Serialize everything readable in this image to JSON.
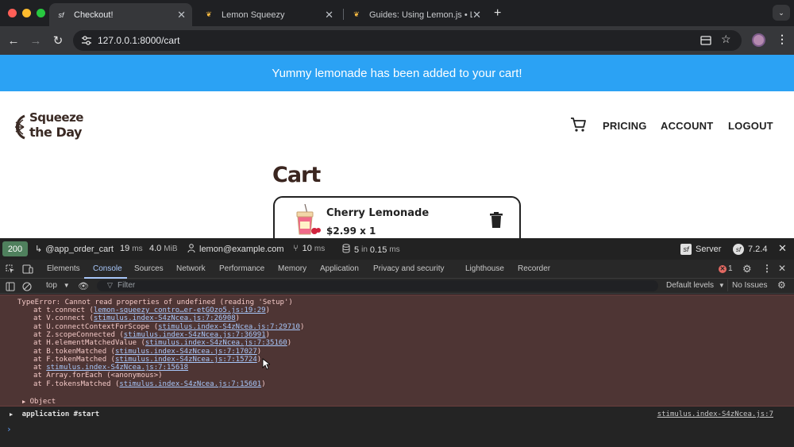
{
  "browser": {
    "tabs": [
      {
        "title": "Checkout!",
        "active": true,
        "favicon": "sf"
      },
      {
        "title": "Lemon Squeezy",
        "active": false,
        "favicon": "lemon-icon"
      },
      {
        "title": "Guides: Using Lemon.js • Lem",
        "active": false,
        "favicon": "lemon-icon"
      }
    ],
    "url": "127.0.0.1:8000/cart"
  },
  "page": {
    "banner": "Yummy lemonade has been added to your cart!",
    "logo": {
      "line1": "Squeeze",
      "line2": "the Day"
    },
    "nav": {
      "pricing": "PRICING",
      "account": "ACCOUNT",
      "logout": "LOGOUT"
    },
    "cart_title": "Cart",
    "item": {
      "name": "Cherry Lemonade",
      "price": "$2.99 x 1"
    }
  },
  "symfony_toolbar": {
    "status": "200",
    "route": "@app_order_cart",
    "time_value": "19",
    "time_unit": "ms",
    "memory_value": "4.0",
    "memory_unit": "MiB",
    "user": "lemon@example.com",
    "profiler_value": "10",
    "profiler_unit": "ms",
    "db_queries": "5",
    "db_in": "in",
    "db_time": "0.15",
    "db_unit": "ms",
    "server": "Server",
    "version": "7.2.4"
  },
  "devtools": {
    "tabs": [
      "Elements",
      "Console",
      "Sources",
      "Network",
      "Performance",
      "Memory",
      "Application",
      "Privacy and security",
      "Lighthouse",
      "Recorder"
    ],
    "active_tab": "Console",
    "error_count": "1",
    "context": "top",
    "filter_placeholder": "Filter",
    "levels": "Default levels",
    "issues": "No Issues",
    "error": {
      "message": "TypeError: Cannot read properties of undefined (reading 'Setup')",
      "stack": [
        {
          "text": "at t.connect (",
          "link": "lemon-squeezy_contro…er-etGOzo5.js:19:29",
          "close": ")"
        },
        {
          "text": "at V.connect (",
          "link": "stimulus.index-S4zNcea.js:7:26908",
          "close": ")"
        },
        {
          "text": "at U.connectContextForScope (",
          "link": "stimulus.index-S4zNcea.js:7:29710",
          "close": ")"
        },
        {
          "text": "at Z.scopeConnected (",
          "link": "stimulus.index-S4zNcea.js:7:36991",
          "close": ")"
        },
        {
          "text": "at H.elementMatchedValue (",
          "link": "stimulus.index-S4zNcea.js:7:35160",
          "close": ")"
        },
        {
          "text": "at B.tokenMatched (",
          "link": "stimulus.index-S4zNcea.js:7:17027",
          "close": ")"
        },
        {
          "text": "at F.tokenMatched (",
          "link": "stimulus.index-S4zNcea.js:7:15724",
          "close": ")"
        },
        {
          "text": "at ",
          "link": "stimulus.index-S4zNcea.js:7:15618",
          "close": ""
        },
        {
          "text": "at Array.forEach (<anonymous>)",
          "link": "",
          "close": ""
        },
        {
          "text": "at F.tokensMatched (",
          "link": "stimulus.index-S4zNcea.js:7:15601",
          "close": ")"
        }
      ],
      "object": "Object"
    },
    "log": {
      "text": "application #start",
      "source": "stimulus.index-S4zNcea.js:7"
    }
  }
}
